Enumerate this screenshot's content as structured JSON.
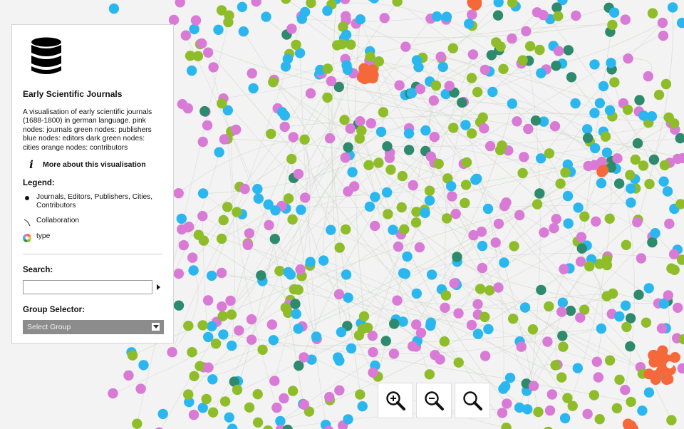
{
  "panel": {
    "logo_icon": "database-icon",
    "title": "Early Scientific Journals",
    "description": "A visualisation of early scientific journals (1688-1800) in german language. pink nodes: journals green nodes: publishers blue nodes: editors dark green nodes: cities orange nodes: contributors",
    "more_link": "More about this visualisation",
    "legend_heading": "Legend:",
    "legend": [
      {
        "icon": "node-dot-icon",
        "label": "Journals, Editors, Publishers, Cities, Contributors"
      },
      {
        "icon": "edge-curve-icon",
        "label": "Collaboration"
      },
      {
        "icon": "color-wheel-icon",
        "label": "type"
      }
    ],
    "search_heading": "Search:",
    "search_value": "",
    "group_heading": "Group Selector:",
    "group_selected": "Select Group"
  },
  "zoom_controls": [
    "zoom-in-icon",
    "zoom-out-icon",
    "zoom-reset-icon"
  ],
  "node_colors": {
    "journals": "#d97ad6",
    "publishers": "#8fbd2a",
    "editors": "#2ab7f0",
    "cities": "#2e8a6c",
    "contributors": "#f5683a"
  }
}
